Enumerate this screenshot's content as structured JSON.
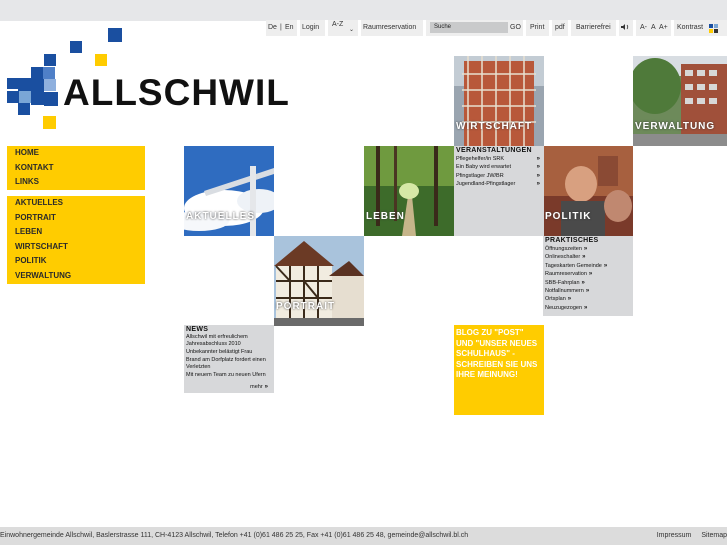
{
  "topbar": {
    "lang_de": "De",
    "lang_sep": "|",
    "lang_en": "En",
    "login": "Login",
    "az": "A-Z",
    "raumreservation": "Raumreservation",
    "search_value": "Suche",
    "go": "GO",
    "print": "Print",
    "pdf": "pdf",
    "barrierefrei": "Barrierefrei",
    "font_small": "A-",
    "font_normal": "A",
    "font_large": "A+",
    "kontrast": "Kontrast"
  },
  "logo": {
    "text": "ALLSCHWIL"
  },
  "nav_top": [
    "HOME",
    "KONTAKT",
    "LINKS"
  ],
  "nav_main": [
    "AKTUELLES",
    "PORTRAIT",
    "LEBEN",
    "WIRTSCHAFT",
    "POLITIK",
    "VERWALTUNG"
  ],
  "tiles": {
    "wirtschaft": "WIRTSCHAFT",
    "verwaltung": "VERWALTUNG",
    "aktuelles": "AKTUELLES",
    "leben": "LEBEN",
    "politik": "POLITIK",
    "portrait": "PORTRAIT"
  },
  "veranstaltungen": {
    "title": "VERANSTALTUNGEN",
    "items": [
      "Pflegehelfer/in SRK",
      "Ein Baby wird erwartet",
      "Pfingstlager JW/BR",
      "Jugendland-Pfingstlager"
    ]
  },
  "praktisches": {
    "title": "PRAKTISCHES",
    "items": [
      "Öffnungszeiten",
      "Onlineschalter",
      "Tageskarten Gemeinde",
      "Raumreservation",
      "SBB-Fahrplan",
      "Notfallnummern",
      "Ortsplan",
      "Neuzugezogen"
    ]
  },
  "news": {
    "title": "NEWS",
    "items": [
      "Allschwil mit erfreulichem Jahresabschluss 2010",
      "Unbekannter belästigt Frau",
      "Brand am Dorfplatz fordert einen Verletzten",
      "Mit neuem Team zu neuen Ufern"
    ],
    "more": "mehr"
  },
  "blog": {
    "text": "BLOG ZU \"POST\" UND \"UNSER NEUES SCHULHAUS\" - SCHREIBEN SIE UNS IHRE MEINUNG!"
  },
  "footer": {
    "address": "Einwohnergemeinde Allschwil, Baslerstrasse 111, CH-4123 Allschwil, Telefon +41 (0)61 486 25 25, Fax +41 (0)61 486 25 48, gemeinde@allschwil.bl.ch",
    "impressum": "Impressum",
    "sitemap": "Sitemap"
  },
  "colors": {
    "brand_yellow": "#ffcc00",
    "brand_blue": "#1a4fa0",
    "panel_gray": "#d7d8da"
  }
}
